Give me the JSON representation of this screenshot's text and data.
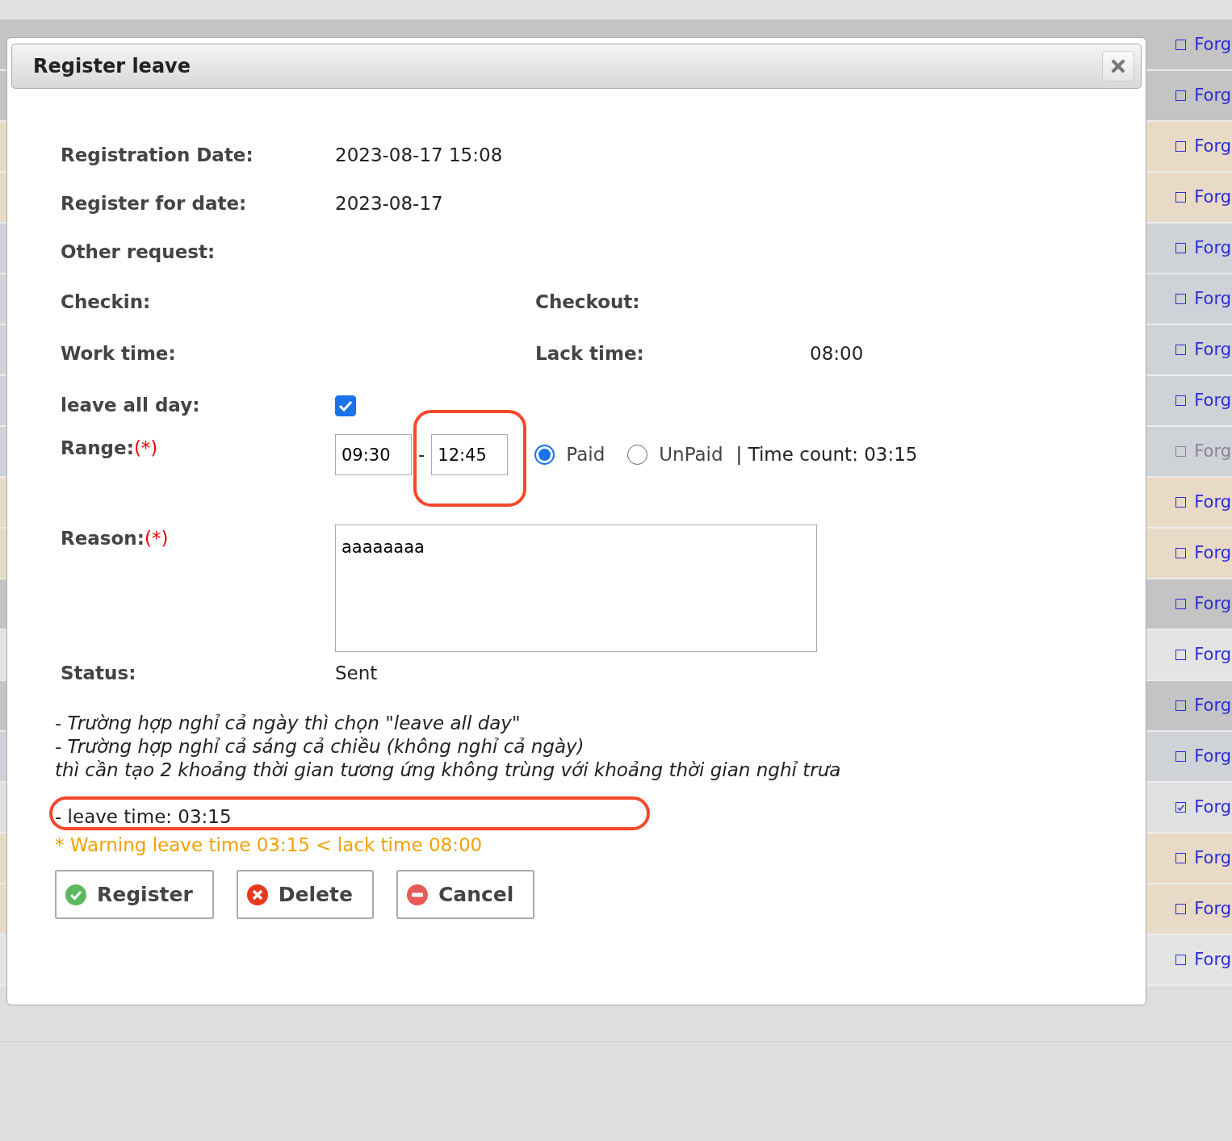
{
  "background_rows": [
    {
      "label": "Forg",
      "checked": false,
      "disabled": false,
      "color": "#c4c4c4"
    },
    {
      "label": "Forg",
      "checked": false,
      "disabled": false,
      "color": "#c4c4c4"
    },
    {
      "label": "Forg",
      "checked": false,
      "disabled": false,
      "color": "#e8dac6"
    },
    {
      "label": "Forg",
      "checked": false,
      "disabled": false,
      "color": "#e8dac6"
    },
    {
      "label": "Forg",
      "checked": false,
      "disabled": false,
      "color": "#cfd2d6"
    },
    {
      "label": "Forg",
      "checked": false,
      "disabled": false,
      "color": "#cfd2d6"
    },
    {
      "label": "Forg",
      "checked": false,
      "disabled": false,
      "color": "#cfd2d6"
    },
    {
      "label": "Forg",
      "checked": false,
      "disabled": false,
      "color": "#cfd2d6"
    },
    {
      "label": "Forg",
      "checked": false,
      "disabled": true,
      "color": "#cfd2d6"
    },
    {
      "label": "Forg",
      "checked": false,
      "disabled": false,
      "color": "#e8dac6"
    },
    {
      "label": "Forg",
      "checked": false,
      "disabled": false,
      "color": "#e8dac6"
    },
    {
      "label": "Forg",
      "checked": false,
      "disabled": false,
      "color": "#c4c4c4"
    },
    {
      "label": "Forg",
      "checked": false,
      "disabled": false,
      "color": "#e4e4e4"
    },
    {
      "label": "Forg",
      "checked": false,
      "disabled": false,
      "color": "#c4c4c4"
    },
    {
      "label": "Forg",
      "checked": false,
      "disabled": false,
      "color": "#cfd2d6"
    },
    {
      "label": "Forg",
      "checked": true,
      "disabled": false,
      "color": "#e0e0e0"
    },
    {
      "label": "Forg",
      "checked": false,
      "disabled": false,
      "color": "#e8dac6"
    },
    {
      "label": "Forg",
      "checked": false,
      "disabled": false,
      "color": "#e8dac6"
    },
    {
      "label": "Forg",
      "checked": false,
      "disabled": false,
      "color": "#e4e4e4"
    }
  ],
  "dialog": {
    "title": "Register leave",
    "registration_date": {
      "label": "Registration Date:",
      "value": "2023-08-17 15:08"
    },
    "register_for_date": {
      "label": "Register for date:",
      "value": "2023-08-17"
    },
    "other_request": {
      "label": "Other request:"
    },
    "checkin": {
      "label": "Checkin:"
    },
    "checkout": {
      "label": "Checkout:"
    },
    "work_time": {
      "label": "Work time:"
    },
    "lack_time": {
      "label": "Lack time:",
      "value": "08:00"
    },
    "leave_all_day": {
      "label": "leave all day:",
      "checked": true
    },
    "range": {
      "label": "Range:",
      "required_mark": "(*)",
      "from": "09:30",
      "separator": "-",
      "to": "12:45",
      "options": [
        {
          "label": "Paid",
          "selected": true
        },
        {
          "label": "UnPaid",
          "selected": false
        }
      ],
      "divider": "|",
      "time_count": "Time count: 03:15"
    },
    "reason": {
      "label": "Reason:",
      "required_mark": "(*)",
      "value": "aaaaaaaa"
    },
    "status": {
      "label": "Status:",
      "value": "Sent"
    },
    "notes": [
      "- Trường hợp nghỉ cả ngày thì chọn \"leave all day\"",
      "- Trường hợp nghỉ cả sáng cả chiều (không nghỉ cả ngày)",
      "thì cần tạo 2 khoảng thời gian tương ứng không trùng với khoảng thời gian nghỉ trưa"
    ],
    "leave_time": "- leave time: 03:15",
    "warning": "* Warning leave time 03:15 < lack time 08:00",
    "buttons": [
      {
        "label": "Register",
        "kind": "register"
      },
      {
        "label": "Delete",
        "kind": "delete"
      },
      {
        "label": "Cancel",
        "kind": "cancel"
      }
    ]
  }
}
